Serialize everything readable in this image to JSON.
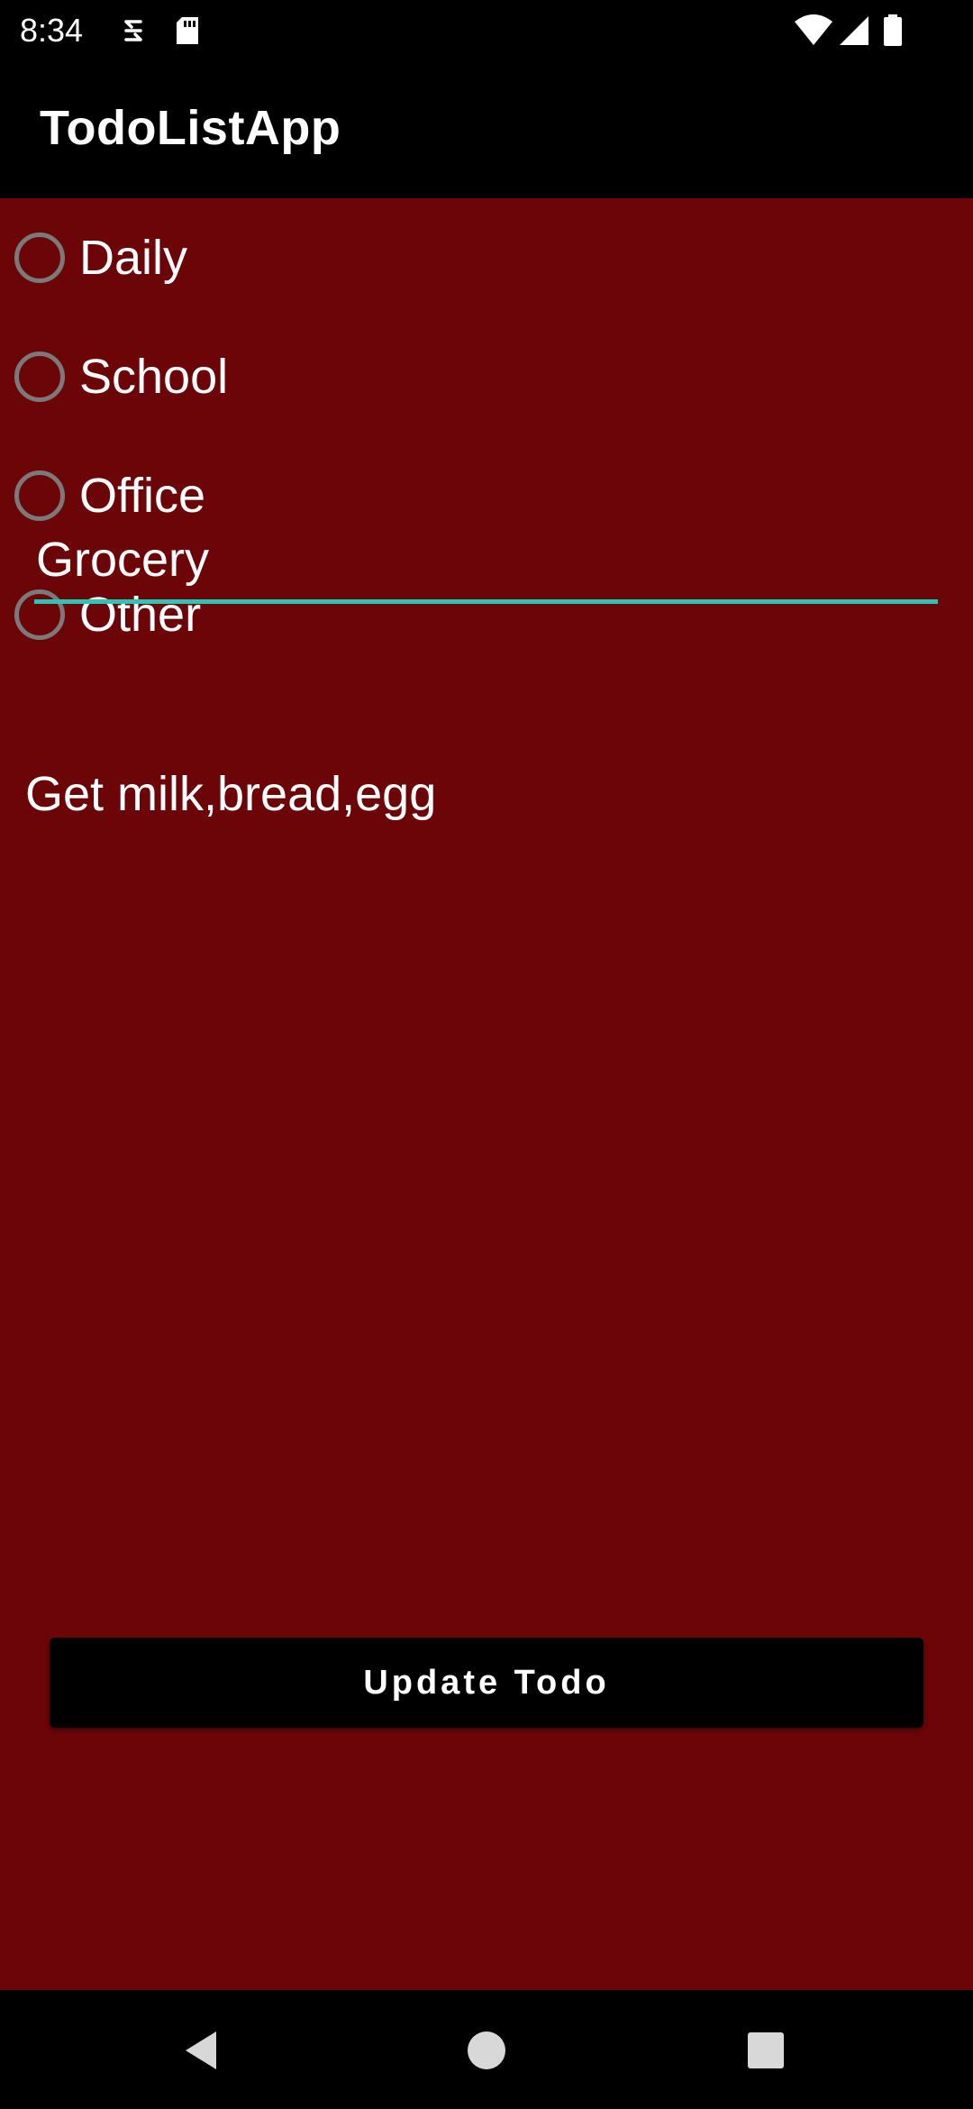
{
  "status_bar": {
    "time": "8:34",
    "icons": [
      "sync-icon",
      "sd-card-icon",
      "wifi-icon",
      "cell-signal-icon",
      "battery-icon"
    ]
  },
  "app_bar": {
    "title": "TodoListApp"
  },
  "categories": {
    "options": [
      {
        "label": "Daily",
        "selected": false
      },
      {
        "label": "School",
        "selected": false
      },
      {
        "label": "Office",
        "selected": false
      },
      {
        "label": "Other",
        "selected": false
      }
    ]
  },
  "form": {
    "title_value": "Grocery",
    "description_value": "Get milk,bread,egg",
    "update_label": "Update Todo"
  },
  "nav_bar": {
    "icons": [
      "back-icon",
      "home-icon",
      "recents-icon"
    ]
  },
  "colors": {
    "background": "#6c0508",
    "accent": "#2ec4b6",
    "bars": "#000000",
    "radio_outline": "#7a7a7a"
  }
}
